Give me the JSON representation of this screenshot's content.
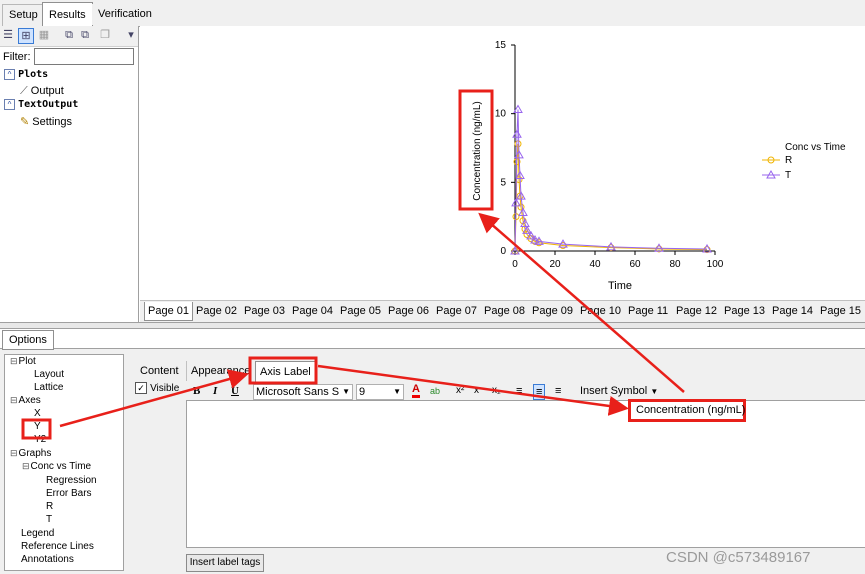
{
  "top_tabs": [
    "Setup",
    "Results",
    "Verification"
  ],
  "filter_label": "Filter:",
  "results_tree": {
    "plots": "Plots",
    "output": "Output",
    "text_output": "TextOutput",
    "settings": "Settings"
  },
  "pages": [
    "Page 01",
    "Page 02",
    "Page 03",
    "Page 04",
    "Page 05",
    "Page 06",
    "Page 07",
    "Page 08",
    "Page 09",
    "Page 10",
    "Page 11",
    "Page 12",
    "Page 13",
    "Page 14",
    "Page 15"
  ],
  "options_tab": "Options",
  "options_tree": {
    "plot": "Plot",
    "layout": "Layout",
    "lattice": "Lattice",
    "axes": "Axes",
    "x": "X",
    "y": "Y",
    "y2": "Y2",
    "graphs": "Graphs",
    "conc_vs_time": "Conc vs Time",
    "regression": "Regression",
    "error_bars": "Error Bars",
    "r": "R",
    "t": "T",
    "legend": "Legend",
    "reference_lines": "Reference Lines",
    "annotations": "Annotations"
  },
  "sub_tabs": [
    "Content",
    "Appearance",
    "Axis Label"
  ],
  "visible_label": "Visible",
  "format": {
    "bold": "B",
    "italic": "I",
    "underline": "U",
    "font": "Microsoft Sans S",
    "size": "9",
    "insert_symbol": "Insert Symbol"
  },
  "axis_label_text": "Concentration (ng/mL)",
  "insert_tags_button": "Insert label tags",
  "watermark": "CSDN @c573489167",
  "colors": {
    "series_r": "#f0b400",
    "series_t": "#9966ee",
    "highlight": "#e8201a"
  },
  "chart_data": {
    "type": "scatter",
    "xlabel": "Time",
    "ylabel": "Concentration (ng/mL)",
    "xlim": [
      0,
      100
    ],
    "ylim": [
      0,
      15
    ],
    "xticks": [
      "0",
      "20",
      "40",
      "60",
      "80",
      "100"
    ],
    "yticks": [
      "0",
      "5",
      "10",
      "15"
    ],
    "legend_title": "Conc vs Time",
    "legend_position": "right",
    "series": [
      {
        "name": "R",
        "marker": "circle",
        "x": [
          0,
          0.5,
          1,
          1.5,
          2,
          2.5,
          3,
          4,
          5,
          6,
          8,
          10,
          12,
          24,
          48,
          72,
          96
        ],
        "y": [
          0,
          2.5,
          6.5,
          7.8,
          5.2,
          4.0,
          3.2,
          2.2,
          1.6,
          1.2,
          0.9,
          0.7,
          0.6,
          0.4,
          0.25,
          0.15,
          0.1
        ]
      },
      {
        "name": "T",
        "marker": "triangle",
        "x": [
          0,
          0.5,
          1,
          1.5,
          2,
          2.5,
          3,
          4,
          5,
          6,
          8,
          10,
          12,
          24,
          48,
          72,
          96
        ],
        "y": [
          0,
          3.5,
          8.5,
          10.3,
          7.0,
          5.5,
          4.0,
          2.8,
          2.0,
          1.5,
          1.1,
          0.8,
          0.7,
          0.5,
          0.3,
          0.2,
          0.15
        ]
      }
    ]
  }
}
